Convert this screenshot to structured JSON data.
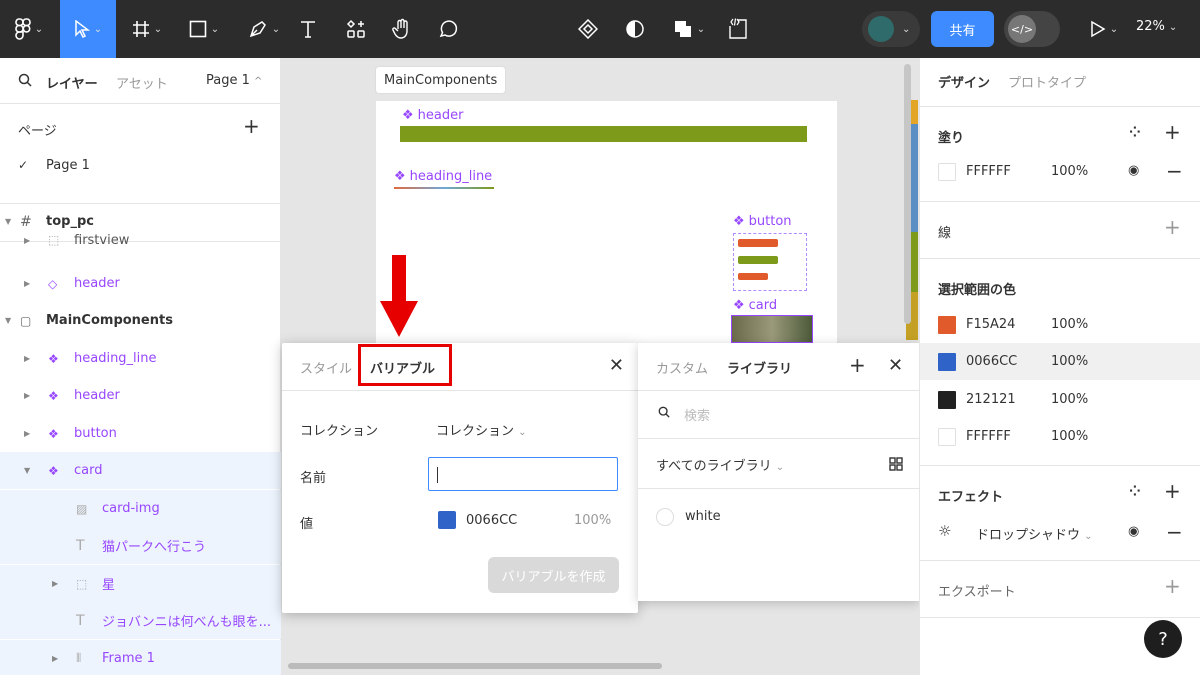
{
  "toolbar": {
    "share_label": "共有",
    "zoom_label": "22%",
    "dev_mode_icon": "</>"
  },
  "left_panel": {
    "tab_layers": "レイヤー",
    "tab_assets": "アセット",
    "page_selector": "Page 1",
    "pages_title": "ページ",
    "current_page": "Page 1",
    "layers": [
      {
        "label": "top_pc"
      },
      {
        "label": "firstview"
      },
      {
        "label": "header"
      },
      {
        "label": "MainComponents"
      },
      {
        "label": "heading_line"
      },
      {
        "label": "header"
      },
      {
        "label": "button"
      },
      {
        "label": "card"
      },
      {
        "label": "card-img"
      },
      {
        "label": "猫パークへ行こう"
      },
      {
        "label": "星"
      },
      {
        "label": "ジョバンニは何べんも眼を..."
      },
      {
        "label": "Frame 1"
      }
    ]
  },
  "canvas": {
    "frame_label": "MainComponents",
    "comp_header": "header",
    "comp_heading_line": "heading_line",
    "comp_button": "button",
    "comp_card": "card"
  },
  "variable_dialog": {
    "tab_style": "スタイル",
    "tab_variable": "バリアブル",
    "collection_label": "コレクション",
    "collection_value": "コレクション",
    "name_label": "名前",
    "name_value": "",
    "value_label": "値",
    "value_hex": "0066CC",
    "value_opacity": "100%",
    "value_color": "#2f63c8",
    "create_button": "バリアブルを作成"
  },
  "library_panel": {
    "tab_custom": "カスタム",
    "tab_library": "ライブラリ",
    "search_placeholder": "検索",
    "filter_label": "すべてのライブラリ",
    "item_white": "white"
  },
  "right_panel": {
    "tab_design": "デザイン",
    "tab_prototype": "プロトタイプ",
    "fill_title": "塗り",
    "fill_hex": "FFFFFF",
    "fill_opacity": "100%",
    "stroke_title": "線",
    "selection_colors_title": "選択範囲の色",
    "selection_colors": [
      {
        "hex": "F15A24",
        "opacity": "100%",
        "color": "#e05a2b"
      },
      {
        "hex": "0066CC",
        "opacity": "100%",
        "color": "#2f63c8"
      },
      {
        "hex": "212121",
        "opacity": "100%",
        "color": "#212121"
      },
      {
        "hex": "FFFFFF",
        "opacity": "100%",
        "color": "#ffffff"
      }
    ],
    "effects_title": "エフェクト",
    "effect_name": "ドロップシャドウ",
    "export_title": "エクスポート"
  },
  "help_label": "?"
}
